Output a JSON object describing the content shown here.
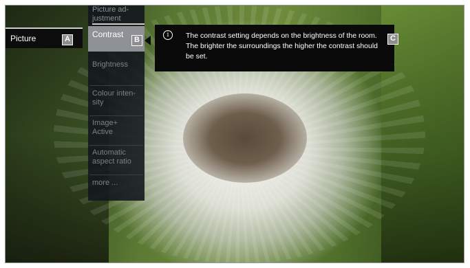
{
  "left_tab": {
    "label": "Picture"
  },
  "menu": {
    "header_line1": "Picture ad-",
    "header_line2": "justment",
    "items": [
      {
        "label": "Contrast"
      },
      {
        "label": "Brightness"
      },
      {
        "label_line1": "Colour inten-",
        "label_line2": "sity"
      },
      {
        "label_line1": "Image+",
        "label_line2": "Active"
      },
      {
        "label_line1": "Automatic",
        "label_line2": "aspect ratio"
      },
      {
        "label": "more ..."
      }
    ]
  },
  "info": {
    "icon": "info-icon",
    "text": "The contrast setting depends on the brightness of the room. The brighter the surroundings the higher the contrast should be set."
  },
  "badges": {
    "a": "A",
    "b": "B",
    "c": "C"
  },
  "colors": {
    "menu_bg": "#12161c",
    "active_item": "#8e9196",
    "info_bg": "#0a0a0a",
    "badge": "#8e8e8e"
  }
}
